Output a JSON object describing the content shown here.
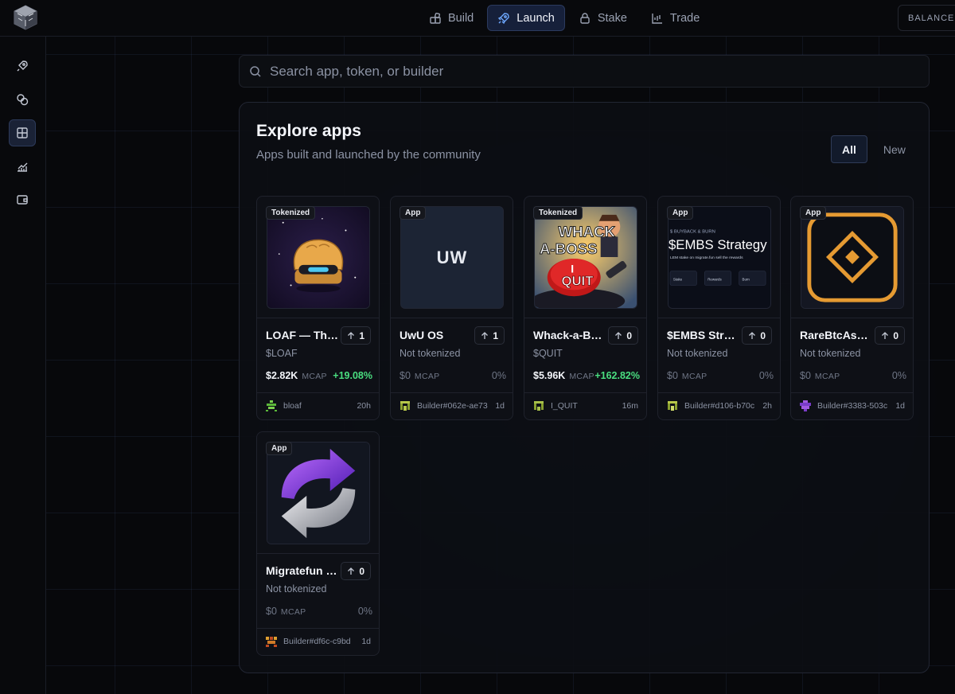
{
  "nav": {
    "items": [
      {
        "label": "Build",
        "icon": "blocks-icon",
        "active": false
      },
      {
        "label": "Launch",
        "icon": "rocket-icon",
        "active": true
      },
      {
        "label": "Stake",
        "icon": "lock-icon",
        "active": false
      },
      {
        "label": "Trade",
        "icon": "chart-icon",
        "active": false
      }
    ],
    "balance_label": "BALANCE"
  },
  "sidebar": {
    "items": [
      {
        "icon": "rocket-icon",
        "active": false
      },
      {
        "icon": "coins-icon",
        "active": false
      },
      {
        "icon": "grid-icon",
        "active": true
      },
      {
        "icon": "trending-chart-icon",
        "active": false
      },
      {
        "icon": "wallet-icon",
        "active": false
      }
    ]
  },
  "search": {
    "placeholder": "Search app, token, or builder",
    "value": ""
  },
  "explore": {
    "title": "Explore apps",
    "subtitle": "Apps built and launched by the community",
    "filters": [
      {
        "label": "All",
        "active": true
      },
      {
        "label": "New",
        "active": false
      }
    ]
  },
  "apps": [
    {
      "badge": "Tokenized",
      "name": "LOAF — The Loaf",
      "ticker": "$LOAF",
      "upvotes": "1",
      "mcap": "$2.82K",
      "mcap_label": "MCAP",
      "change": "+19.08%",
      "builder": "bloaf",
      "time": "20h"
    },
    {
      "badge": "App",
      "name": "UwU OS",
      "ticker": "Not tokenized",
      "upvotes": "1",
      "mcap": "$0",
      "mcap_label": "MCAP",
      "change": "0%",
      "builder": "Builder#062e-ae73",
      "time": "1d",
      "image_text": "UW"
    },
    {
      "badge": "Tokenized",
      "name": "Whack-a-Boss",
      "ticker": "$QUIT",
      "upvotes": "0",
      "mcap": "$5.96K",
      "mcap_label": "MCAP",
      "change": "+162.82%",
      "builder": "I_QUIT",
      "time": "16m",
      "image_text_1": "WHACK",
      "image_text_2": "A-BOSS",
      "image_text_3": "I",
      "image_text_4": "QUIT"
    },
    {
      "badge": "App",
      "name": "$EMBS Strategy",
      "ticker": "Not tokenized",
      "upvotes": "0",
      "mcap": "$0",
      "mcap_label": "MCAP",
      "change": "0%",
      "builder": "Builder#d106-b70c",
      "time": "2h",
      "image_text_1": "$ BUYBACK & BURN",
      "image_text_2": "$EMBS Strategy",
      "image_text_3": "LEM  stake on migrate.fun  sell the rewards",
      "image_text_4": "Stake",
      "image_text_5": "Rewards",
      "image_text_6": "Burn"
    },
    {
      "badge": "App",
      "name": "RareBtcAssets",
      "ticker": "Not tokenized",
      "upvotes": "0",
      "mcap": "$0",
      "mcap_label": "MCAP",
      "change": "0%",
      "builder": "Builder#3383-503c",
      "time": "1d"
    },
    {
      "badge": "App",
      "name": "Migratefun Swap",
      "ticker": "Not tokenized",
      "upvotes": "0",
      "mcap": "$0",
      "mcap_label": "MCAP",
      "change": "0%",
      "builder": "Builder#df6c-c9bd",
      "time": "1d"
    }
  ],
  "colors": {
    "accent": "#6ea8ff",
    "positive": "#4ade80",
    "panel": "#0e1016"
  }
}
